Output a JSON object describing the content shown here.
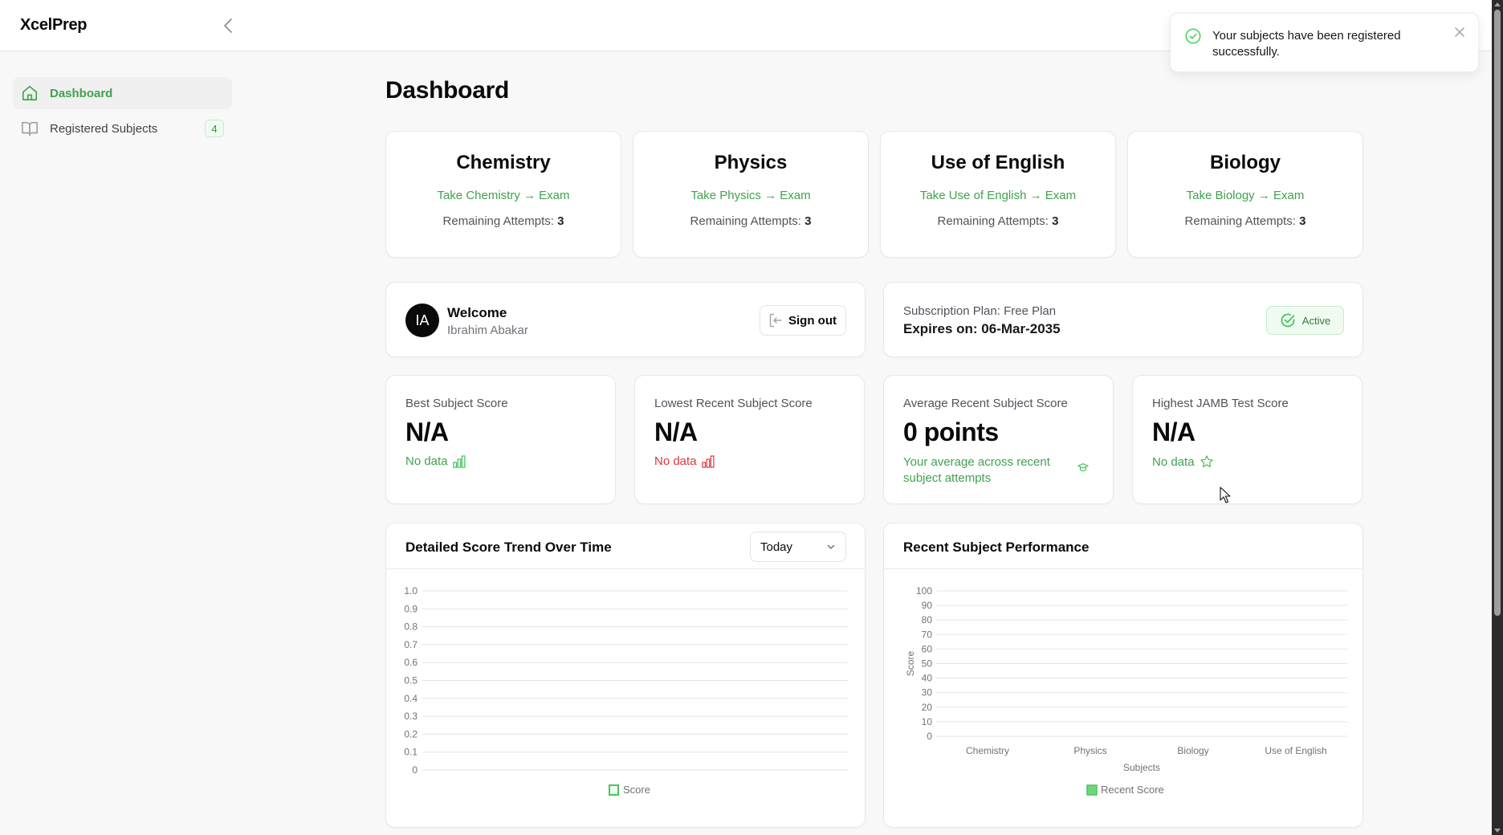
{
  "app": {
    "title": "XcelPrep"
  },
  "sidebar": {
    "items": [
      {
        "label": "Dashboard",
        "icon": "home-icon",
        "active": true
      },
      {
        "label": "Registered Subjects",
        "icon": "book-open-icon",
        "badge": "4",
        "active": false
      }
    ]
  },
  "page": {
    "title": "Dashboard"
  },
  "subjects": [
    {
      "name": "Chemistry",
      "link": "Take Chemistry → Exam",
      "attempts_label": "Remaining Attempts:",
      "attempts": "3"
    },
    {
      "name": "Physics",
      "link": "Take Physics → Exam",
      "attempts_label": "Remaining Attempts:",
      "attempts": "3"
    },
    {
      "name": "Use of English",
      "link": "Take Use of English → Exam",
      "attempts_label": "Remaining Attempts:",
      "attempts": "3"
    },
    {
      "name": "Biology",
      "link": "Take Biology → Exam",
      "attempts_label": "Remaining Attempts:",
      "attempts": "3"
    }
  ],
  "welcome": {
    "initials": "IA",
    "title": "Welcome",
    "name": "Ibrahim Abakar",
    "signout_label": "Sign out"
  },
  "subscription": {
    "plan": "Subscription Plan: Free Plan",
    "expires": "Expires on: 06-Mar-2035",
    "status": "Active"
  },
  "stats": [
    {
      "label": "Best Subject Score",
      "value": "N/A",
      "sub": "No data",
      "tone": "green",
      "icon": "bar-chart-icon"
    },
    {
      "label": "Lowest Recent Subject Score",
      "value": "N/A",
      "sub": "No data",
      "tone": "red",
      "icon": "bar-chart-icon"
    },
    {
      "label": "Average Recent Subject Score",
      "value": "0 points",
      "sub": "Your average across recent subject attempts",
      "tone": "green",
      "icon": "graduation-cap-icon"
    },
    {
      "label": "Highest JAMB Test Score",
      "value": "N/A",
      "sub": "No data",
      "tone": "green",
      "icon": "star-icon"
    }
  ],
  "colors": {
    "accent": "#3fa34d",
    "danger": "#e0353b",
    "legend_fill": "#6fd57c"
  },
  "toast": {
    "message": "Your subjects have been registered successfully."
  },
  "chart_data": [
    {
      "type": "line",
      "title": "Detailed Score Trend Over Time",
      "filter": {
        "selected": "Today"
      },
      "x": [],
      "series": [
        {
          "name": "Score",
          "values": []
        }
      ],
      "xlabel": "",
      "ylabel": "",
      "ylim": [
        0,
        1.0
      ],
      "yticks": [
        "0",
        "0.1",
        "0.2",
        "0.3",
        "0.4",
        "0.5",
        "0.6",
        "0.7",
        "0.8",
        "0.9",
        "1.0"
      ],
      "grid": true,
      "legend": "bottom-center"
    },
    {
      "type": "bar",
      "title": "Recent Subject Performance",
      "categories": [
        "Chemistry",
        "Physics",
        "Biology",
        "Use of English"
      ],
      "series": [
        {
          "name": "Recent Score",
          "values": [
            0,
            0,
            0,
            0
          ]
        }
      ],
      "xlabel": "Subjects",
      "ylabel": "Score",
      "ylim": [
        0,
        100
      ],
      "yticks": [
        "0",
        "10",
        "20",
        "30",
        "40",
        "50",
        "60",
        "70",
        "80",
        "90",
        "100"
      ],
      "grid": true,
      "legend": "bottom-center"
    }
  ]
}
